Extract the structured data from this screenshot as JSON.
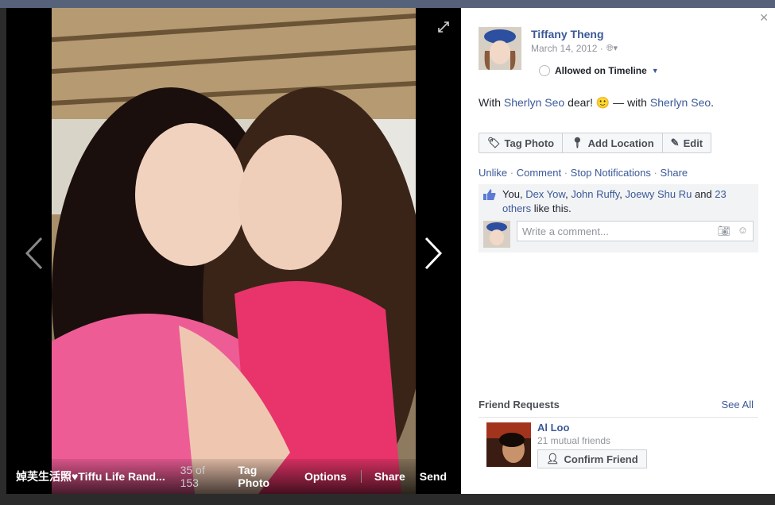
{
  "viewer": {
    "album_title": "婥芙生活照♥Tiffu Life Rand...",
    "counter": "35 of 153",
    "bar_links": {
      "tag": "Tag Photo",
      "options": "Options",
      "share": "Share",
      "send": "Send"
    }
  },
  "post": {
    "author": "Tiffany Theng",
    "date": "March 14, 2012 ·",
    "timeline_label": "Allowed on Timeline",
    "caption": {
      "with_prefix": "With",
      "friend1": "Sherlyn Seo",
      "mid": "dear! 🙂 — with",
      "friend2": "Sherlyn Seo",
      "end": "."
    },
    "buttons": {
      "tag": "Tag Photo",
      "location": "Add Location",
      "edit": "Edit"
    },
    "actions": {
      "unlike": "Unlike",
      "comment": "Comment",
      "stop": "Stop Notifications",
      "share": "Share",
      "separator": "·"
    },
    "likes": {
      "you": "You,",
      "p1": "Dex Yow",
      "p2": "John Ruffy",
      "p3": "Joewy Shu Ru",
      "and": "and",
      "others": "23 others",
      "tail": "like this.",
      "sep": ","
    },
    "comment_placeholder": "Write a comment..."
  },
  "friend_requests": {
    "header": "Friend Requests",
    "see_all": "See All",
    "name": "Al Loo",
    "mutual": "21 mutual friends",
    "confirm": "Confirm Friend"
  },
  "colors": {
    "link": "#3b5998",
    "shirt": "#e8346a",
    "hair": "#1a0f0c"
  }
}
